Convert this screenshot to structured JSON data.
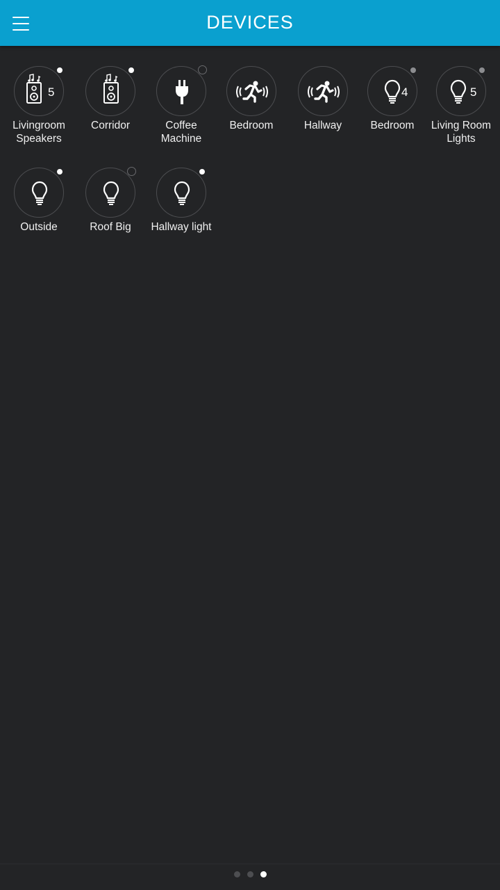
{
  "header": {
    "title": "DEVICES",
    "menu_icon": "hamburger-menu-icon",
    "bar_color": "#0aa0cf"
  },
  "devices": [
    {
      "name": "Livingroom Speakers",
      "icon": "speaker-music-icon",
      "count": "5",
      "status": "on"
    },
    {
      "name": "Corridor",
      "icon": "speaker-music-icon",
      "count": "",
      "status": "on"
    },
    {
      "name": "Coffee Machine",
      "icon": "plug-icon",
      "count": "",
      "status": "off"
    },
    {
      "name": "Bedroom",
      "icon": "motion-sensor-icon",
      "count": "",
      "status": "none"
    },
    {
      "name": "Hallway",
      "icon": "motion-sensor-icon",
      "count": "",
      "status": "none"
    },
    {
      "name": "Bedroom",
      "icon": "light-bulb-icon",
      "count": "4",
      "status": "mid"
    },
    {
      "name": "Living Room Lights",
      "icon": "light-bulb-icon",
      "count": "5",
      "status": "mid"
    },
    {
      "name": "Outside",
      "icon": "light-bulb-icon",
      "count": "",
      "status": "on"
    },
    {
      "name": "Roof Big",
      "icon": "light-bulb-icon",
      "count": "",
      "status": "off"
    },
    {
      "name": "Hallway light",
      "icon": "light-bulb-icon",
      "count": "",
      "status": "on"
    }
  ],
  "pager": {
    "pages": 3,
    "active_page": 3
  },
  "colors": {
    "background": "#232426",
    "accent": "#0aa0cf",
    "status_on": "#ffffff",
    "status_mid": "#8c8d90"
  }
}
